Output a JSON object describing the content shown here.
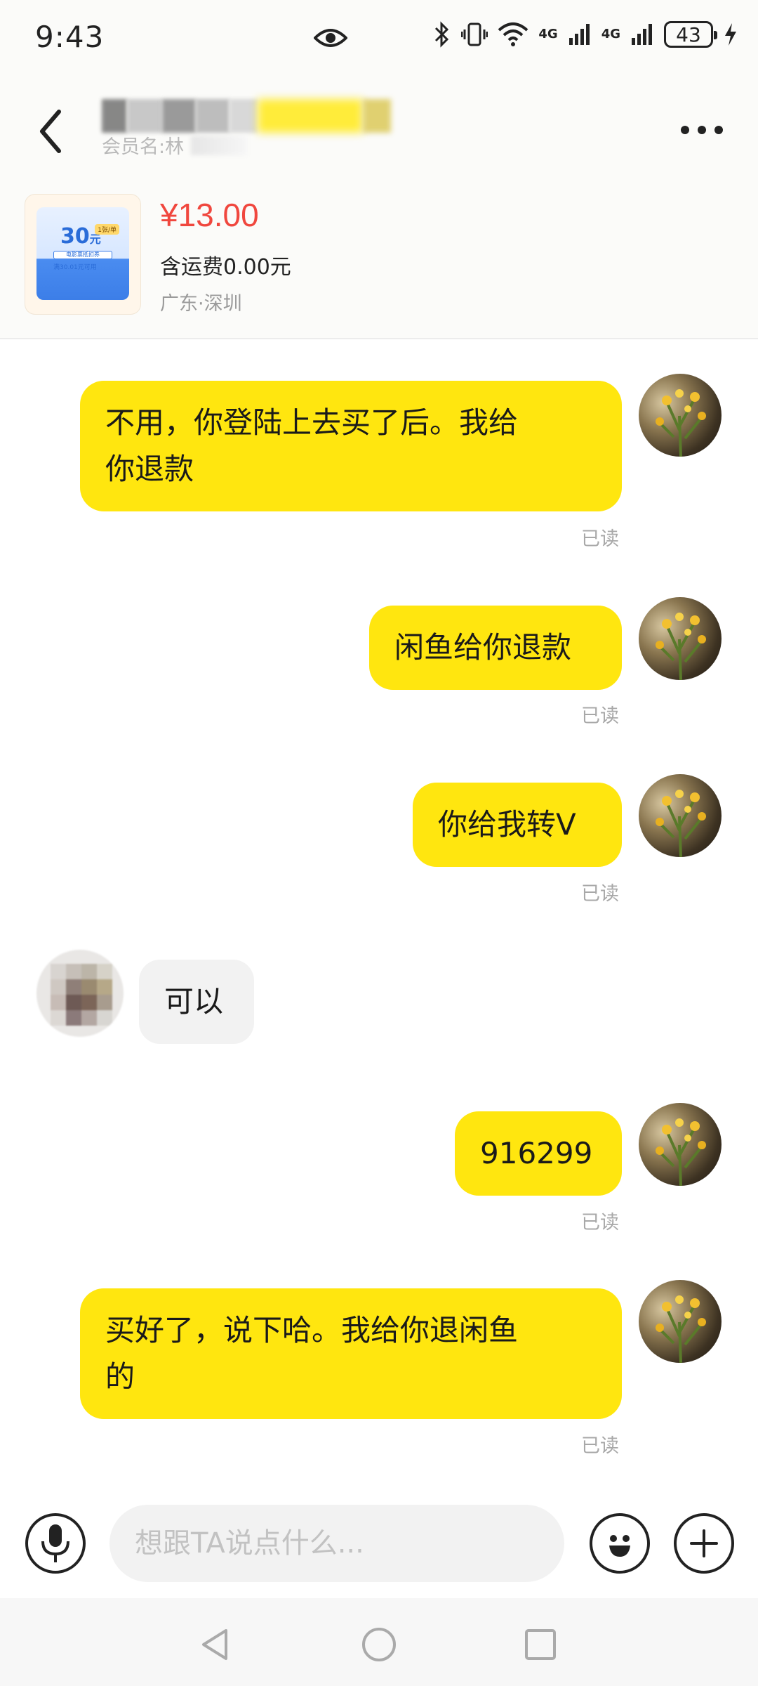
{
  "status_bar": {
    "time": "9:43",
    "network_1": "4G",
    "network_2": "4G",
    "battery": "43"
  },
  "header": {
    "member_label": "会员名:林"
  },
  "product": {
    "price": "¥13.00",
    "shipping": "含运费0.00元",
    "location": "广东·深圳",
    "thumb_value": "30",
    "thumb_unit": "元",
    "thumb_tag": "1张/单",
    "thumb_line1": "电影票抵扣券",
    "thumb_line2": "满30.01元可用"
  },
  "messages": [
    {
      "sender": "me",
      "lines": [
        "不用，你登陆上去买了后。我给",
        "你退款"
      ],
      "status": "已读"
    },
    {
      "sender": "me",
      "lines": [
        "闲鱼给你退款"
      ],
      "status": "已读"
    },
    {
      "sender": "me",
      "lines": [
        "你给我转V"
      ],
      "status": "已读"
    },
    {
      "sender": "other",
      "lines": [
        "可以"
      ]
    },
    {
      "sender": "me",
      "lines": [
        "916299"
      ],
      "status": "已读"
    },
    {
      "sender": "me",
      "lines": [
        "买好了，说下哈。我给你退闲鱼",
        "的"
      ],
      "status": "已读"
    }
  ],
  "input": {
    "placeholder": "想跟TA说点什么..."
  },
  "colors": {
    "my_bubble": "#ffe60f",
    "other_bubble": "#f2f2f2",
    "price": "#f0473e"
  },
  "icons": [
    "back-icon",
    "more-icon",
    "eye-icon",
    "bluetooth-icon",
    "vibrate-icon",
    "wifi-icon",
    "signal-icon",
    "charging-icon",
    "mic-icon",
    "emoji-icon",
    "plus-icon",
    "nav-back-icon",
    "nav-home-icon",
    "nav-recents-icon"
  ]
}
